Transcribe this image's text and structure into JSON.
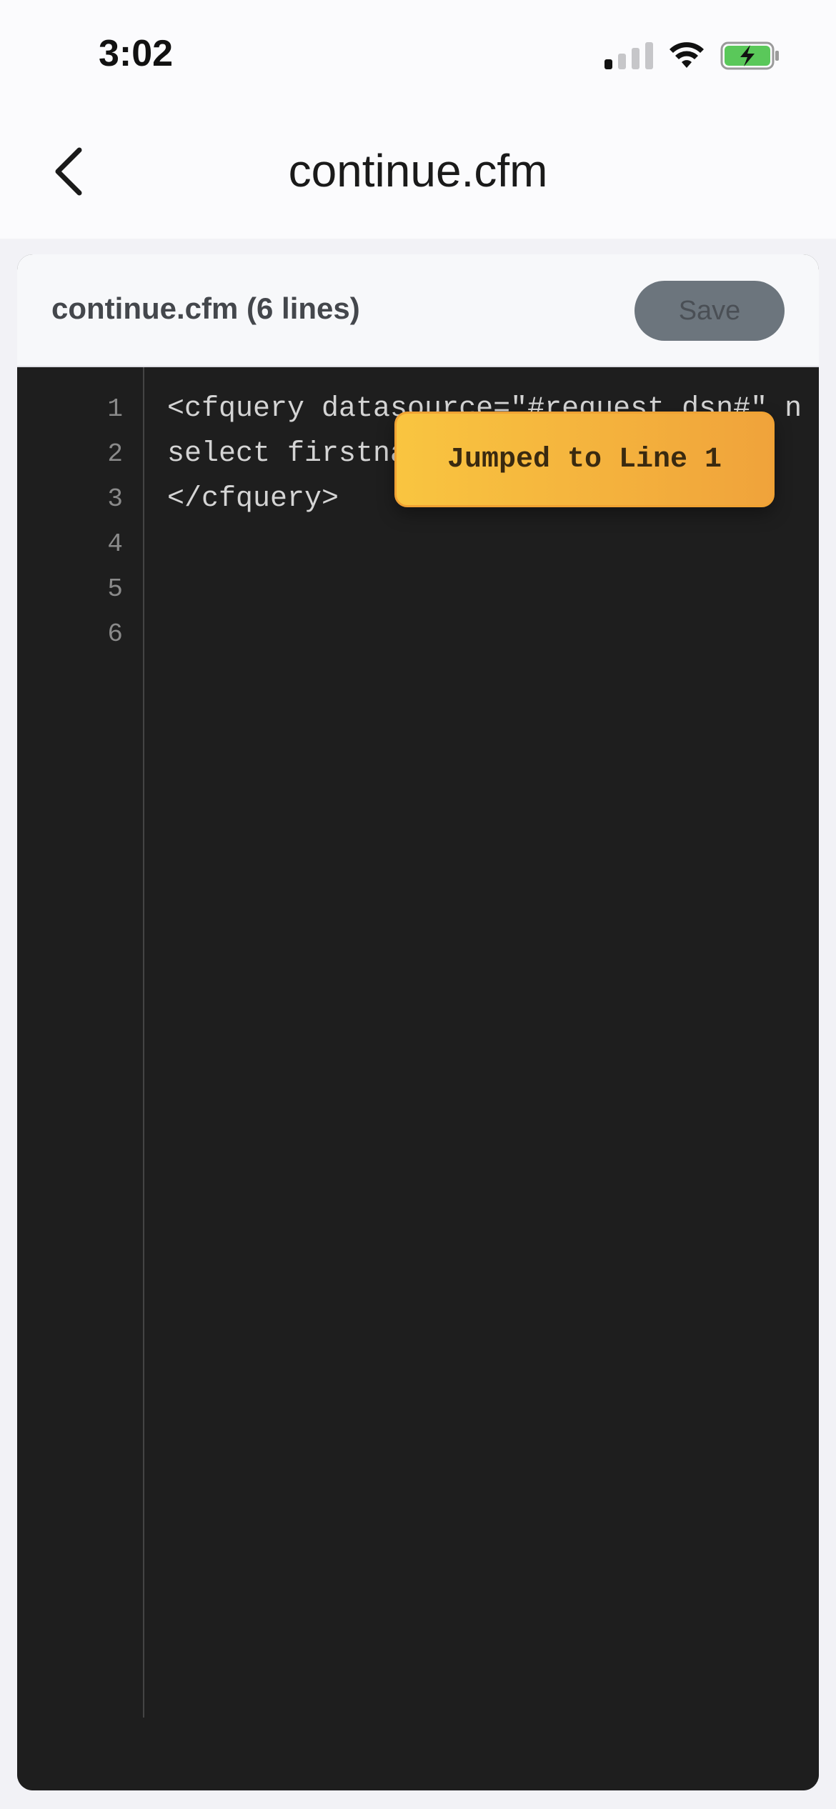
{
  "status_bar": {
    "time": "3:02",
    "icons": [
      "cellular-signal-icon",
      "wifi-icon",
      "battery-charging-icon"
    ]
  },
  "nav": {
    "back_icon": "chevron-left-icon",
    "title": "continue.cfm"
  },
  "editor_header": {
    "file_info": "continue.cfm (6 lines)",
    "save_label": "Save"
  },
  "editor": {
    "line_numbers": [
      "1",
      "2",
      "3",
      "4",
      "5",
      "6"
    ],
    "lines": [
      "<cfquery datasource=\"#request.dsn#\" n",
      "select firstname, lastname",
      "</cfquery>",
      "",
      "",
      ""
    ]
  },
  "toast": {
    "message": "Jumped to Line 1"
  },
  "colors": {
    "editor_bg": "#1e1e1e",
    "toast_start": "#f9c540",
    "toast_end": "#f0a33b",
    "save_button": "#6c757d"
  }
}
